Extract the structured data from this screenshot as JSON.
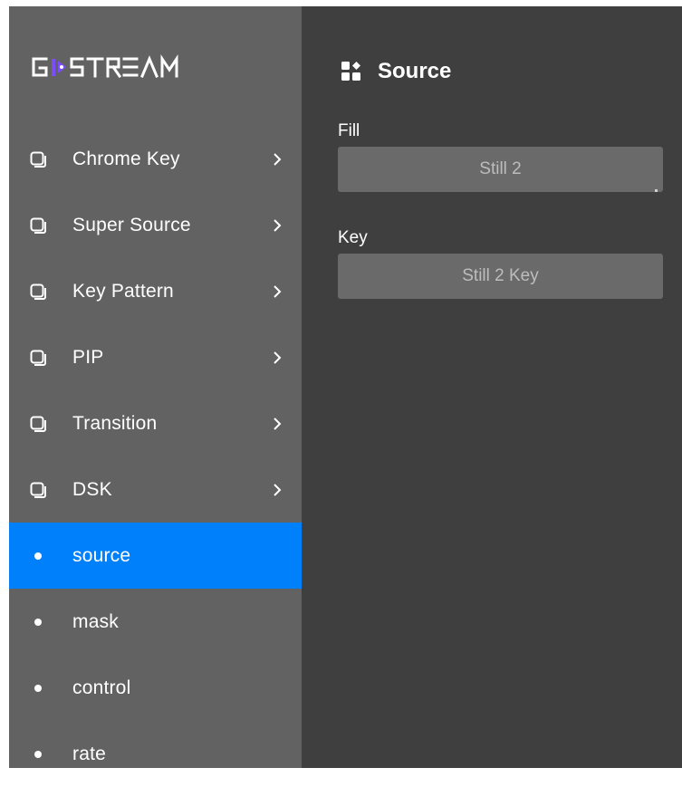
{
  "brand": {
    "logo_text": "GOSTREAM",
    "accent_color": "#7b4dff"
  },
  "sidebar": {
    "background": "#626262",
    "active_color": "#0080fb",
    "items": [
      {
        "label": "Chrome Key",
        "icon": "square-stack-icon",
        "has_chevron": true
      },
      {
        "label": "Super Source",
        "icon": "square-stack-icon",
        "has_chevron": true
      },
      {
        "label": "Key Pattern",
        "icon": "square-stack-icon",
        "has_chevron": true
      },
      {
        "label": "PIP",
        "icon": "square-stack-icon",
        "has_chevron": true
      },
      {
        "label": "Transition",
        "icon": "square-stack-icon",
        "has_chevron": true
      },
      {
        "label": "DSK",
        "icon": "square-stack-icon",
        "has_chevron": true
      },
      {
        "label": "source",
        "icon": "dot-icon",
        "active": true
      },
      {
        "label": "mask",
        "icon": "dot-icon"
      },
      {
        "label": "control",
        "icon": "dot-icon"
      },
      {
        "label": "rate",
        "icon": "dot-icon"
      }
    ]
  },
  "panel": {
    "title": "Source",
    "title_icon": "grid-icon",
    "background": "#3f3f3f",
    "fill": {
      "label": "Fill",
      "value": "Still 2"
    },
    "key": {
      "label": "Key",
      "value": "Still 2 Key"
    }
  }
}
